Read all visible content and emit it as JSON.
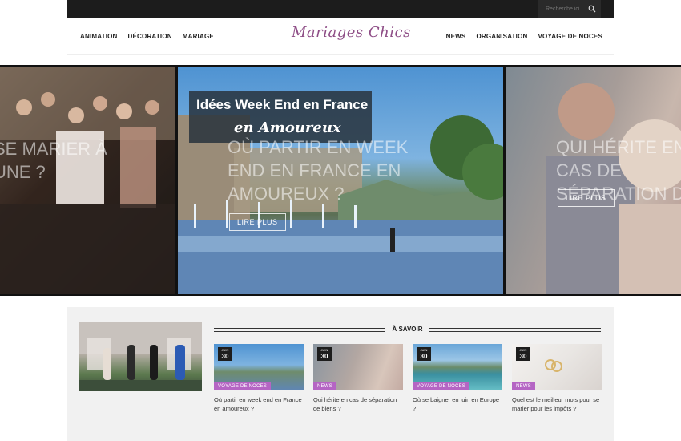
{
  "topbar": {
    "search_placeholder": "Recherche ici"
  },
  "header": {
    "logo": "Mariages Chics",
    "nav_left": [
      "ANIMATION",
      "DÉCORATION",
      "MARIAGE"
    ],
    "nav_right": [
      "NEWS",
      "ORGANISATION",
      "VOYAGE DE NOCES"
    ]
  },
  "hero": {
    "slides": [
      {
        "title": "SE MARIER À UNE ?"
      },
      {
        "banner_line1": "Idées Week End en France",
        "banner_line2": "en Amoureux",
        "title": "OÙ PARTIR EN WEEK END EN FRANCE EN AMOUREUX ?",
        "button": "LIRE PLUS"
      },
      {
        "title": "QUI HÉRITE EN CAS DE SÉPARATION DE",
        "button": "LIRE PLUS"
      }
    ]
  },
  "section": {
    "title": "À SAVOIR",
    "cards": [
      {
        "month": "JUIN",
        "day": "30",
        "category": "VOYAGE DE NOCES",
        "title": "Où partir en week end en France en amoureux ?"
      },
      {
        "month": "JUIN",
        "day": "30",
        "category": "NEWS",
        "title": "Qui hérite en cas de séparation de biens ?"
      },
      {
        "month": "JUIN",
        "day": "30",
        "category": "VOYAGE DE NOCES",
        "title": "Où se baigner en juin en Europe ?"
      },
      {
        "month": "JUIN",
        "day": "30",
        "category": "NEWS",
        "title": "Quel est le meilleur mois pour se marier pour les impôts ?"
      }
    ]
  },
  "colors": {
    "topbar": "#1c1c1c",
    "logo": "#8e4d86",
    "category_badge": "#b565c4"
  }
}
